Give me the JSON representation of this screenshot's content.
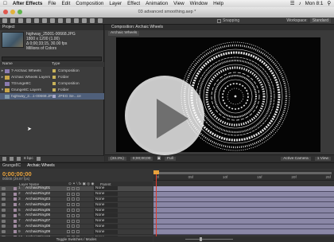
{
  "menubar": {
    "app_name": "After Effects",
    "items": [
      "File",
      "Edit",
      "Composition",
      "Layer",
      "Effect",
      "Animation",
      "View",
      "Window",
      "Help"
    ],
    "clock": "Mon 8:1"
  },
  "window": {
    "title": "03 advanced smoothing.aep *"
  },
  "toolbar": {
    "snapping_label": "Snapping",
    "workspace_label": "Workspace:",
    "workspace_value": "Standard"
  },
  "project": {
    "panel_title": "Project",
    "selected_file": "highway_25001-00668.JPG",
    "meta": [
      "1800 x 1200 (1.00)",
      "Δ 0;00;33;15, 30.00 fps",
      "Millions of Colors"
    ],
    "search_placeholder": "",
    "columns": [
      "Name",
      "Type"
    ],
    "items": [
      {
        "name": "7-Archaic Wheels",
        "type": "Composition",
        "kind": "comp",
        "label_color": "#c8b25a",
        "expanded": false
      },
      {
        "name": "Archaic Wheels Layers",
        "type": "Folder",
        "kind": "folder",
        "label_color": "#c8b25a",
        "expanded": false
      },
      {
        "name": "7Grunge8C",
        "type": "Composition",
        "kind": "comp",
        "label_color": "#c8b25a",
        "expanded": false
      },
      {
        "name": "Grunge8C Layers",
        "type": "Folder",
        "kind": "folder",
        "label_color": "#c8b25a",
        "expanded": true
      },
      {
        "name": "highway_2...1-00668.JPG",
        "type": "JPEG Se...ce",
        "kind": "footage",
        "label_color": "#a7a7c9",
        "selected": true
      }
    ],
    "bpc": "8 bpc"
  },
  "composition": {
    "tab_label": "Composition: Archaic Wheels",
    "sub_tab": "Archaic Wheels",
    "zoom": "(33.3%)",
    "timecode": "0;00;00;00",
    "resolution": "Full",
    "camera": "Active Camera",
    "views": "1 View"
  },
  "timeline": {
    "tabs": [
      "Grunge8C",
      "Archaic Wheels"
    ],
    "timecode": "0;00;00;00",
    "timecode_sub": "00000 (29.97 fps)",
    "headers": [
      "Layer Name",
      "⊙ ✶ \\ fx ▣ ◎ ◉",
      "Parent"
    ],
    "layers": [
      {
        "num": "1",
        "name": "ArchaicRing01",
        "parent": "None"
      },
      {
        "num": "2",
        "name": "ArchaicRing02",
        "parent": "None"
      },
      {
        "num": "3",
        "name": "ArchaicRing03",
        "parent": "None"
      },
      {
        "num": "4",
        "name": "ArchaicRing04",
        "parent": "None"
      },
      {
        "num": "5",
        "name": "ArchaicRing05",
        "parent": "None"
      },
      {
        "num": "6",
        "name": "ArchaicRing06",
        "parent": "None"
      },
      {
        "num": "7",
        "name": "ArchaicRing07",
        "parent": "None"
      },
      {
        "num": "8",
        "name": "ArchaicRing08",
        "parent": "None"
      },
      {
        "num": "9",
        "name": "ArchaicRing09",
        "parent": "None"
      },
      {
        "num": "10",
        "name": "ArchaicRing10",
        "parent": "None"
      }
    ],
    "ruler_ticks": [
      "0f",
      "05f",
      "10f",
      "15f",
      "20f",
      "25f"
    ],
    "footer": "Toggle Switches / Modes"
  },
  "overlay": {
    "icon": "play-icon"
  },
  "colors": {
    "timecode": "#e8a23c",
    "layer_bar": "#8a87a6",
    "cti": "#e23b2b"
  }
}
